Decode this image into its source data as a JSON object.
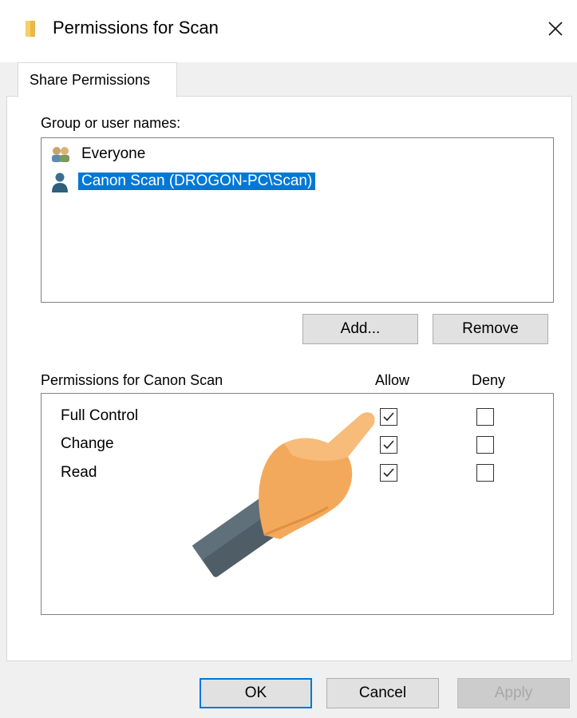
{
  "window": {
    "title": "Permissions for Scan",
    "icon": "folder-icon"
  },
  "tabs": [
    {
      "label": "Share Permissions",
      "active": true
    }
  ],
  "groups": {
    "label": "Group or user names:",
    "items": [
      {
        "name": "Everyone",
        "icon": "users-group-icon",
        "selected": false
      },
      {
        "name": "Canon Scan (DROGON-PC\\Scan)",
        "icon": "user-icon",
        "selected": true
      }
    ]
  },
  "buttons": {
    "add": "Add...",
    "remove": "Remove",
    "ok": "OK",
    "cancel": "Cancel",
    "apply": "Apply"
  },
  "permissions": {
    "label": "Permissions for Canon Scan",
    "allow_header": "Allow",
    "deny_header": "Deny",
    "rows": [
      {
        "name": "Full Control",
        "allow": true,
        "deny": false
      },
      {
        "name": "Change",
        "allow": true,
        "deny": false
      },
      {
        "name": "Read",
        "allow": true,
        "deny": false
      }
    ]
  },
  "colors": {
    "selection": "#0078d7",
    "hand_skin": "#f3a95b",
    "cuff": "#4a5a63"
  }
}
